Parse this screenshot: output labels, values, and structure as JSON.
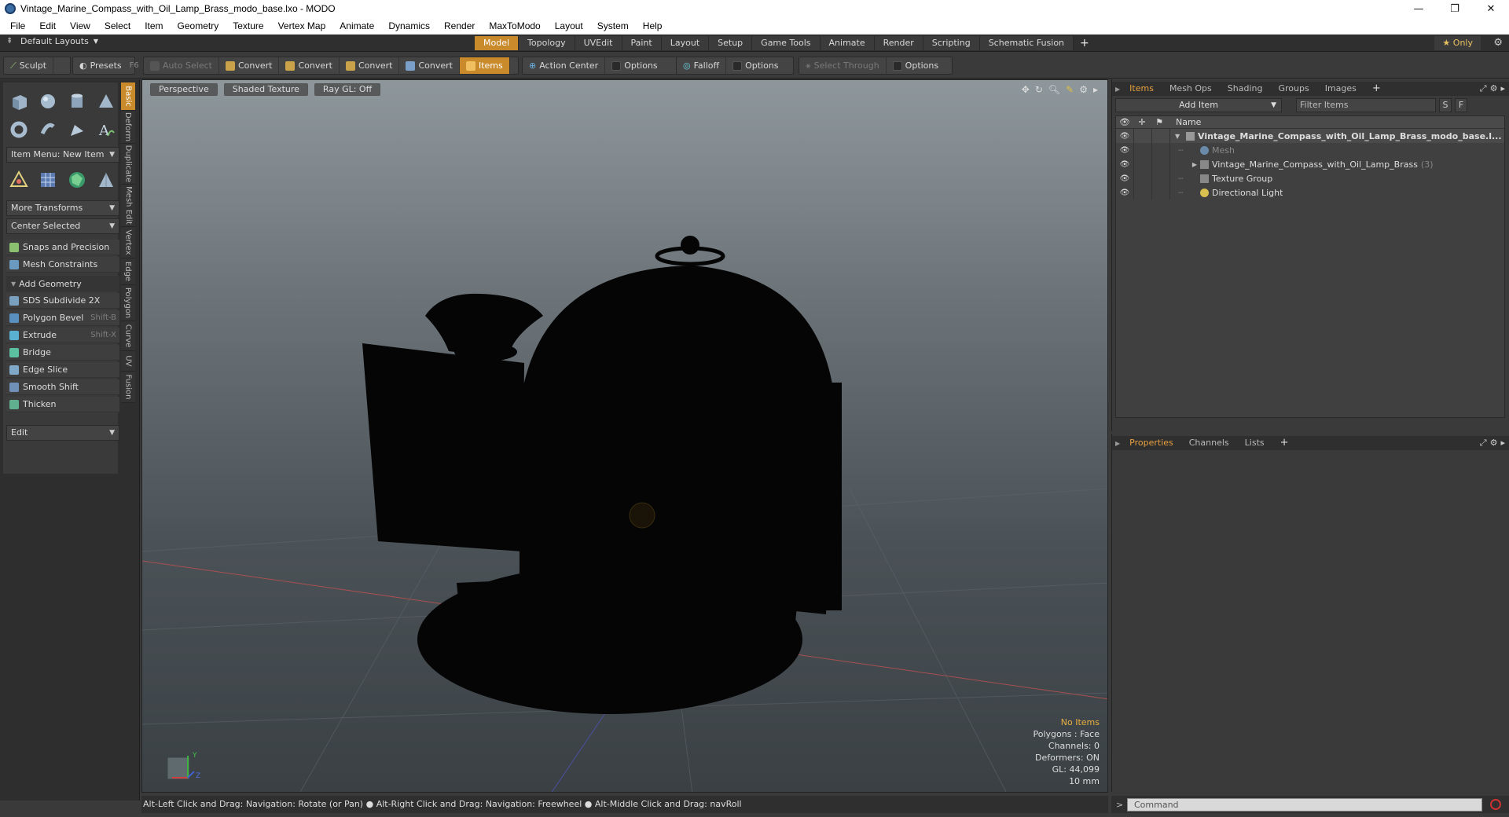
{
  "window": {
    "title": "Vintage_Marine_Compass_with_Oil_Lamp_Brass_modo_base.lxo - MODO",
    "minimize": "—",
    "restore": "❐",
    "close": "✕"
  },
  "menu": [
    "File",
    "Edit",
    "View",
    "Select",
    "Item",
    "Geometry",
    "Texture",
    "Vertex Map",
    "Animate",
    "Dynamics",
    "Render",
    "MaxToModo",
    "Layout",
    "System",
    "Help"
  ],
  "layoutbar": {
    "layouts_label": "Default Layouts",
    "tabs": [
      "Model",
      "Topology",
      "UVEdit",
      "Paint",
      "Layout",
      "Setup",
      "Game Tools",
      "Animate",
      "Render",
      "Scripting",
      "Schematic Fusion"
    ],
    "active_tab": "Model",
    "add": "+",
    "only_label": "Only"
  },
  "toolbar": {
    "sculpt": "Sculpt",
    "presets": "Presets",
    "presets_key": "F6",
    "auto_select": "Auto Select",
    "convert1": "Convert",
    "convert2": "Convert",
    "convert3": "Convert",
    "convert4": "Convert",
    "items": "Items",
    "action_center": "Action Center",
    "options1": "Options",
    "falloff": "Falloff",
    "options2": "Options",
    "select_through": "Select Through",
    "options3": "Options"
  },
  "leftpanel": {
    "item_menu": "Item Menu: New Item",
    "more_transforms": "More Transforms",
    "center_selected": "Center Selected",
    "snaps": "Snaps and Precision",
    "mesh_constraints": "Mesh Constraints",
    "add_geometry": "Add Geometry",
    "tools": [
      {
        "label": "SDS Subdivide 2X",
        "key": ""
      },
      {
        "label": "Polygon Bevel",
        "key": "Shift-B"
      },
      {
        "label": "Extrude",
        "key": "Shift-X"
      },
      {
        "label": "Bridge",
        "key": ""
      },
      {
        "label": "Edge Slice",
        "key": ""
      },
      {
        "label": "Smooth Shift",
        "key": ""
      },
      {
        "label": "Thicken",
        "key": ""
      }
    ],
    "edit_dropdown": "Edit",
    "vtabs": [
      "Basic",
      "Deform",
      "Duplicate",
      "Mesh Edit",
      "Vertex",
      "Edge",
      "Polygon",
      "Curve",
      "UV",
      "Fusion"
    ]
  },
  "viewport": {
    "view": "Perspective",
    "shading": "Shaded Texture",
    "raygl": "Ray GL: Off",
    "info": {
      "selection": "No Items",
      "polygons": "Polygons : Face",
      "channels": "Channels: 0",
      "deformers": "Deformers: ON",
      "gl": "GL: 44,099",
      "scale": "10 mm"
    },
    "axis_y": "Y",
    "axis_z": "Z"
  },
  "statusbar": "Alt-Left Click and Drag: Navigation: Rotate (or Pan) ● Alt-Right Click and Drag: Navigation: Freewheel ● Alt-Middle Click and Drag: navRoll",
  "items_panel": {
    "tabs": [
      "Items",
      "Mesh Ops",
      "Shading",
      "Groups",
      "Images"
    ],
    "active_tab": "Items",
    "add": "+",
    "add_item": "Add Item",
    "filter_placeholder": "Filter Items",
    "s_btn": "S",
    "f_btn": "F",
    "name_header": "Name",
    "rows": [
      {
        "label": "Vintage_Marine_Compass_with_Oil_Lamp_Brass_modo_base.l...",
        "indent": 0
      },
      {
        "label": "Mesh",
        "indent": 1
      },
      {
        "label": "Vintage_Marine_Compass_with_Oil_Lamp_Brass",
        "count": "(3)",
        "indent": 1
      },
      {
        "label": "Texture Group",
        "indent": 1
      },
      {
        "label": "Directional Light",
        "indent": 1
      }
    ]
  },
  "properties_panel": {
    "tabs": [
      "Properties",
      "Channels",
      "Lists"
    ],
    "active_tab": "Properties",
    "add": "+"
  },
  "command": {
    "placeholder": "Command"
  },
  "colors": {
    "accent": "#c98a2b",
    "warn_text": "#e8b040"
  }
}
